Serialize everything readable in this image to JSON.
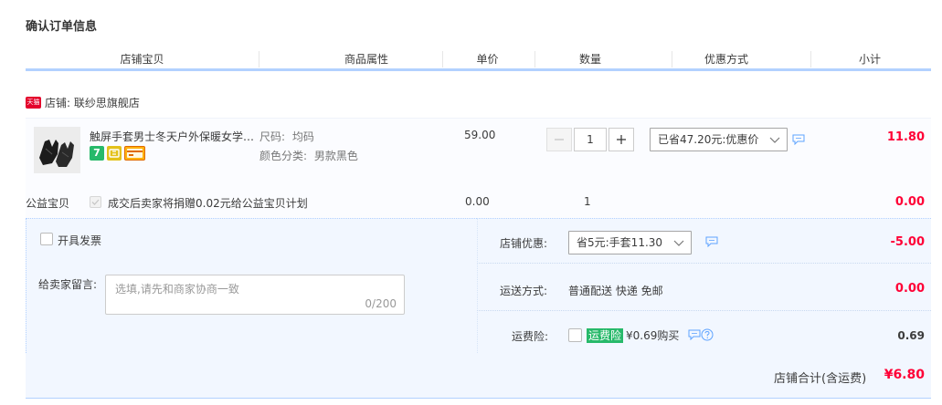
{
  "section_title": "确认订单信息",
  "columns": [
    "店铺宝贝",
    "商品属性",
    "单价",
    "数量",
    "优惠方式",
    "小计"
  ],
  "shop": {
    "badge": "天猫",
    "label": "店铺: 联纱思旗舰店"
  },
  "item": {
    "title": "触屏手套男士冬天户外保暖女学生加厚骑行防风冬季",
    "badges": [
      "7",
      "",
      ""
    ],
    "attributes": [
      {
        "label": "尺码:",
        "value": "均码"
      },
      {
        "label": "颜色分类:",
        "value": "男款黑色"
      }
    ],
    "unit_price": "59.00",
    "quantity": "1",
    "discount_select": "已省47.20元:优惠价",
    "subtotal": "11.80"
  },
  "charity": {
    "label": "公益宝贝",
    "text": "成交后卖家将捐赠0.02元给公益宝贝计划",
    "price": "0.00",
    "quantity": "1",
    "subtotal": "0.00"
  },
  "invoice": {
    "label": "开具发票"
  },
  "memo": {
    "label": "给卖家留言:",
    "placeholder": "选填,请先和商家协商一致",
    "count": "0/200"
  },
  "shop_discount": {
    "label": "店铺优惠:",
    "select": "省5元:手套11.30",
    "amount": "-5.00"
  },
  "shipping": {
    "label": "运送方式:",
    "value": "普通配送 快递 免邮",
    "amount": "0.00"
  },
  "insurance": {
    "label": "运费险:",
    "tag": "运费险",
    "text": "¥0.69购买",
    "amount": "0.69"
  },
  "total": {
    "label": "店铺合计(含运费)",
    "amount": "¥6.80"
  },
  "colors": {
    "accent_red": "#ff0036",
    "header_line": "#b2d1ff",
    "panel_bg": "#f2f7ff",
    "tag_green": "#27b96a"
  },
  "icons": [
    "tmall-icon",
    "chat-icon",
    "help-icon",
    "chevron-down-icon",
    "minus-icon",
    "plus-icon",
    "check-icon"
  ]
}
